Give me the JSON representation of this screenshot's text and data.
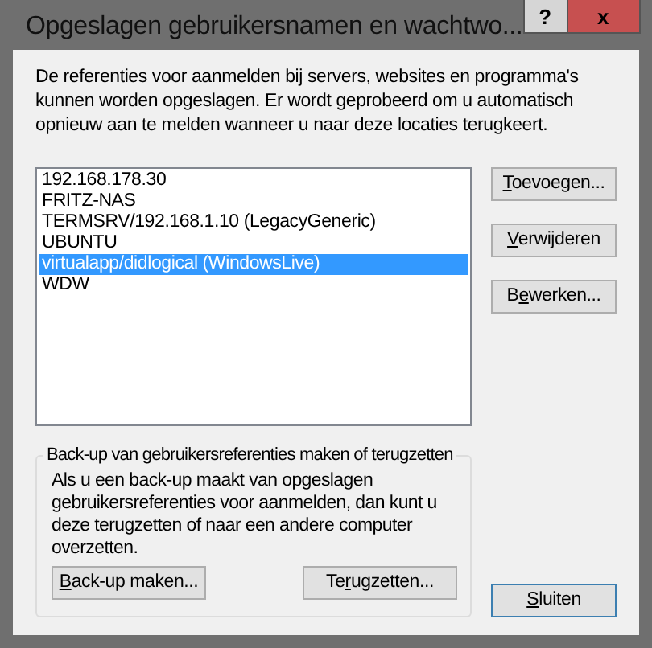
{
  "window": {
    "title": "Opgeslagen gebruikersnamen en wachtwo...",
    "help_button": "?",
    "close_button": "x"
  },
  "description": "De referenties voor aanmelden bij servers, websites en programma's kunnen worden opgeslagen. Er wordt geprobeerd om u automatisch opnieuw aan te melden wanneer u naar deze locaties terugkeert.",
  "credentials": [
    {
      "label": "192.168.178.30",
      "selected": false
    },
    {
      "label": "FRITZ-NAS",
      "selected": false
    },
    {
      "label": "TERMSRV/192.168.1.10 (LegacyGeneric)",
      "selected": false
    },
    {
      "label": "UBUNTU",
      "selected": false
    },
    {
      "label": "virtualapp/didlogical (WindowsLive)",
      "selected": true
    },
    {
      "label": "WDW",
      "selected": false
    }
  ],
  "side_buttons": [
    {
      "access_key": "T",
      "label_end": "oevoegen..."
    },
    {
      "access_key": "V",
      "label_end": "erwijderen"
    },
    {
      "label_start": "B",
      "access_key": "e",
      "label_end": "werken..."
    }
  ],
  "backup_group": {
    "legend": "Back-up van gebruikersreferenties maken of terugzetten",
    "text": "Als u een back-up maakt van opgeslagen gebruikersreferenties voor aanmelden, dan kunt u deze terugzetten of naar een andere computer overzetten.",
    "buttons": [
      {
        "access_key": "B",
        "label_end": "ack-up maken..."
      },
      {
        "label_start": "Te",
        "access_key": "r",
        "label_end": "ugzetten..."
      }
    ]
  },
  "close_dialog_button": {
    "access_key": "S",
    "label_end": "luiten",
    "default": true
  }
}
